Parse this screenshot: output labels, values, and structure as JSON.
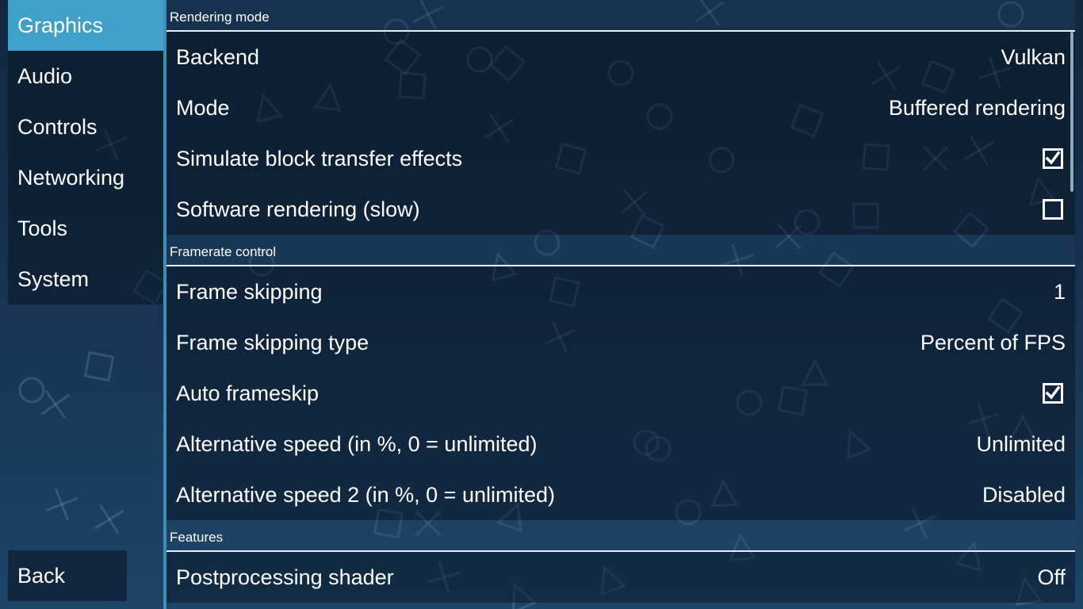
{
  "sidebar": {
    "tabs": [
      {
        "label": "Graphics",
        "active": true
      },
      {
        "label": "Audio",
        "active": false
      },
      {
        "label": "Controls",
        "active": false
      },
      {
        "label": "Networking",
        "active": false
      },
      {
        "label": "Tools",
        "active": false
      },
      {
        "label": "System",
        "active": false
      }
    ],
    "back_label": "Back"
  },
  "sections": [
    {
      "header": "Rendering mode",
      "rows": [
        {
          "label": "Backend",
          "value": "Vulkan"
        },
        {
          "label": "Mode",
          "value": "Buffered rendering"
        },
        {
          "label": "Simulate block transfer effects",
          "checked": true
        },
        {
          "label": "Software rendering (slow)",
          "checked": false
        }
      ]
    },
    {
      "header": "Framerate control",
      "rows": [
        {
          "label": "Frame skipping",
          "value": "1"
        },
        {
          "label": "Frame skipping type",
          "value": "Percent of FPS"
        },
        {
          "label": "Auto frameskip",
          "checked": true
        },
        {
          "label": "Alternative speed (in %, 0 = unlimited)",
          "value": "Unlimited"
        },
        {
          "label": "Alternative speed 2 (in %, 0 = unlimited)",
          "value": "Disabled"
        }
      ]
    },
    {
      "header": "Features",
      "rows": [
        {
          "label": "Postprocessing shader",
          "value": "Off"
        }
      ]
    }
  ],
  "colors": {
    "accent": "#3fa1c9",
    "background_top": "#13283f",
    "background_bottom": "#1d4466"
  },
  "icons": {
    "checked": "checkbox-checked-icon",
    "unchecked": "checkbox-unchecked-icon",
    "background": [
      "cross-icon",
      "circle-icon",
      "square-icon",
      "triangle-icon"
    ]
  }
}
